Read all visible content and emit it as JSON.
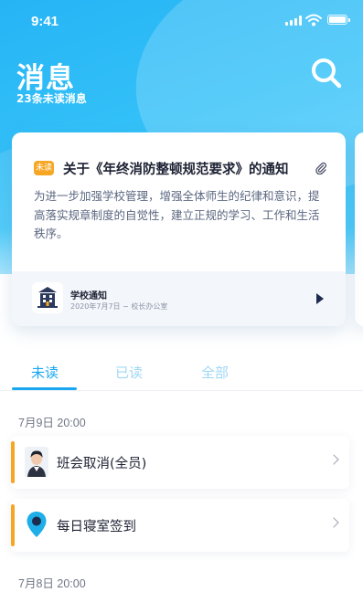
{
  "status": {
    "time": "9:41"
  },
  "header": {
    "title": "消息",
    "subtitle": "23条未读消息"
  },
  "featured": {
    "badge": "未读",
    "title": "关于《年终消防整顿规范要求》的通知",
    "body": "为进一步加强学校管理，增强全体师生的纪律和意识，提高落实规章制度的自觉性，建立正规的学习、工作和生活秩序。",
    "source": "学校通知",
    "meta": "2020年7月7日 ~ 校长办公室"
  },
  "tabs": [
    {
      "label": "未读",
      "active": true
    },
    {
      "label": "已读",
      "active": false
    },
    {
      "label": "全部",
      "active": false
    }
  ],
  "groups": [
    {
      "date": "7月9日 20:00",
      "items": [
        {
          "label": "班会取消(全员)",
          "icon": "avatar"
        },
        {
          "label": "每日寝室签到",
          "icon": "location-pin-icon"
        }
      ]
    },
    {
      "date": "7月8日 20:00",
      "items": []
    }
  ],
  "colors": {
    "accent": "#1aa7f2",
    "unread": "#f6a623",
    "hero": "#34c1f8"
  }
}
